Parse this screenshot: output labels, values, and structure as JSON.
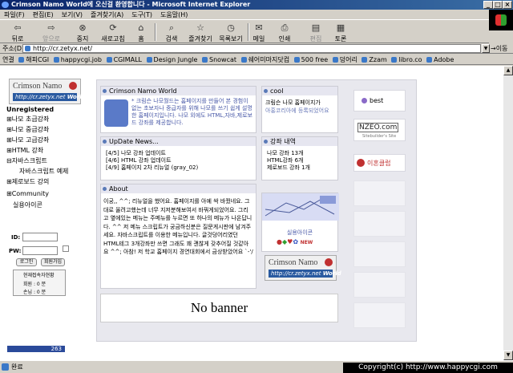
{
  "window": {
    "title": "Crimson Namo World에 오신걸 환영합니다 - Microsoft Internet Explorer",
    "controls": [
      "_",
      "□",
      "×"
    ]
  },
  "menu": [
    "파일(F)",
    "편집(E)",
    "보기(V)",
    "즐겨찾기(A)",
    "도구(T)",
    "도움말(H)"
  ],
  "toolbar": {
    "back": "뒤로",
    "forward": "앞으로",
    "stop": "중지",
    "refresh": "새로고침",
    "home": "홈",
    "search": "검색",
    "favorites": "즐겨찾기",
    "history": "목록보기",
    "mail": "메일",
    "print": "인쇄",
    "edit": "편집",
    "discuss": "토론"
  },
  "address": {
    "label": "주소(D)",
    "url": "http://cr.zetyx.net/",
    "go": "이동"
  },
  "links": {
    "label": "연결",
    "items": [
      "해피CGI",
      "happycgi.job",
      "CGIMALL",
      "Design Jungle",
      "Snowcat",
      "쉐어미마지닷컴",
      "500 free",
      "덩어리",
      "Zzam",
      "libro.co",
      "Adobe"
    ]
  },
  "site": {
    "logo_text": "Crimson Namo",
    "logo_url": "http://cr.zetyx.net",
    "logo_world": "World",
    "user_status": "Unregistered",
    "nav": [
      "나모 초급강좌",
      "나모 중급강좌",
      "나모 고급강좌",
      "HTML 강좌",
      "자바스크립트"
    ],
    "nav_sub": "자바스크립트 예제",
    "nav2": [
      "제로보드 강의",
      "Community"
    ],
    "nav2_sub": "실용아이콘",
    "login": {
      "id_label": "ID:",
      "pw_label": "PW:",
      "login_btn": "로그인",
      "join_btn": "회원가입",
      "counter_title": "현재접속자현황",
      "members": "회원 : 0 분",
      "guests": "손님 : 0 분"
    },
    "hit_count": "263",
    "welcome": {
      "title": "Crimson Namo World",
      "text": "* 크림슨 나모월드는 홈페이지를 만들어 본 경험이 없는 초보자나 중급자를 위해 나모를 쓰기 쉽게 설명한 홈페이지입니다. 나모 외에도 HTML,자바,제로보드 강좌를 제공합니다."
    },
    "cool": {
      "title": "cool",
      "text": "크림슨 나모 홈페이지가",
      "text2": "아홍코리아에 등록되었어요"
    },
    "update": {
      "title": "UpDate News...",
      "items": [
        "[4/5] 나모 강좌 업데이트",
        "[4/6] HTML 강좌 업데이트",
        "[4/9] 홈페이지 2차 리뉴얼 (gray_02)"
      ]
    },
    "lecture": {
      "title": "강좌 내역",
      "items": [
        "나모 강좌 13개",
        "HTML강좌 6개",
        "제로보드 강좌 1개"
      ]
    },
    "about": {
      "title": "About",
      "text": "이궁,, ^^; 리뉴얼을 했어요. 홈페이지를 아예 싹 바꿨네요. 그대로 올려고했는데 너무 지저분해보여서 바꿔게되었어요. 그리고 옆에있는 메뉴는 주메뉴를 누르면 또 하나의 메뉴가 나온답니다. ^^ 저 메뉴 스크립트가 궁금하신분은 질문게시판에 남겨주세요. 자바스크립트를 이용한 메뉴입니다. 글것덩어리였던 HTML테그 3개강좌만 쓰면 그래도 꽤 괜찮게 갖추어질 것같아요 ^^; 아참! 저 학교 홈페이지 경연대회에서 금상받았어요 `-'/"
    },
    "icons_label": "실용아이콘",
    "icons_new": "NEW",
    "best_label": "best",
    "nzeo": "NZEO.com",
    "nzeo_sub": "Sitebuilder's Site",
    "sponsor": "이혼클럽",
    "banner": "No banner"
  },
  "status": {
    "text": "완료",
    "copyright": "Copyright(c) http://www.happycgi.com"
  },
  "colors": {
    "titlebar": "#0a246a",
    "chrome": "#d4d0c8",
    "panel": "#e8e8ee",
    "accent_red": "#c03030"
  }
}
